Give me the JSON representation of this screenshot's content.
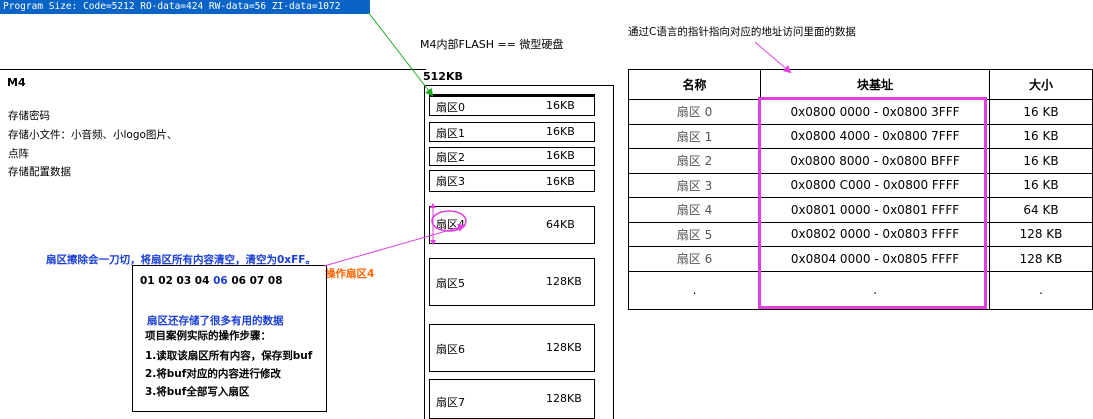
{
  "program_size": "Program Size: Code=5212 RO-data=424 RW-data=56 ZI-data=1072",
  "flash_title": "M4内部FLASH == 微型硬盘",
  "pointer_note": "通过C语言的指针指向对应的地址访问里面的数据",
  "m4": {
    "title": "M4",
    "lines": [
      "存储密码",
      "存储小文件：小音频、小logo图片、",
      "点阵",
      "存储配置数据"
    ]
  },
  "flash_size": "512KB",
  "sectors": [
    {
      "label": "扇区0",
      "size": "16KB"
    },
    {
      "label": "扇区1",
      "size": "16KB"
    },
    {
      "label": "扇区2",
      "size": "16KB"
    },
    {
      "label": "扇区3",
      "size": "16KB"
    },
    {
      "label": "扇区4",
      "size": "64KB"
    },
    {
      "label": "扇区5",
      "size": "128KB"
    },
    {
      "label": "扇区6",
      "size": "128KB"
    },
    {
      "label": "扇区7",
      "size": "128KB"
    }
  ],
  "erase_note": "扇区擦除会一刀切，将扇区所有内容清空，清空为0xFF。",
  "operate_label": "操作扇区4",
  "bytes": {
    "before": "01 02 03 04 ",
    "highlight": "06",
    "after": " 06 07 08"
  },
  "useful_note": "扇区还存储了很多有用的数据",
  "steps_title": "项目案例实际的操作步骤：",
  "steps": [
    "1.读取该扇区所有内容，保存到buf",
    "2.将buf对应的内容进行修改",
    "3.将buf全部写入扇区"
  ],
  "table": {
    "headers": [
      "名称",
      "块基址",
      "大小"
    ],
    "rows": [
      [
        "扇区 0",
        "0x0800 0000 - 0x0800 3FFF",
        "16 KB"
      ],
      [
        "扇区 1",
        "0x0800 4000 - 0x0800 7FFF",
        "16 KB"
      ],
      [
        "扇区 2",
        "0x0800 8000 - 0x0800 BFFF",
        "16 KB"
      ],
      [
        "扇区 3",
        "0x0800 C000 - 0x0800 FFFF",
        "16 KB"
      ],
      [
        "扇区 4",
        "0x0801 0000 - 0x0801 FFFF",
        "64 KB"
      ],
      [
        "扇区 5",
        "0x0802 0000 - 0x0803 FFFF",
        "128 KB"
      ],
      [
        "扇区 6",
        "0x0804 0000 - 0x0805 FFFF",
        "128 KB"
      ],
      [
        ".",
        ".",
        "."
      ]
    ]
  },
  "colors": {
    "blue": "#1a3fd6",
    "magenta": "#e040e0",
    "green": "#22aa22",
    "orange": "#ff6600"
  }
}
